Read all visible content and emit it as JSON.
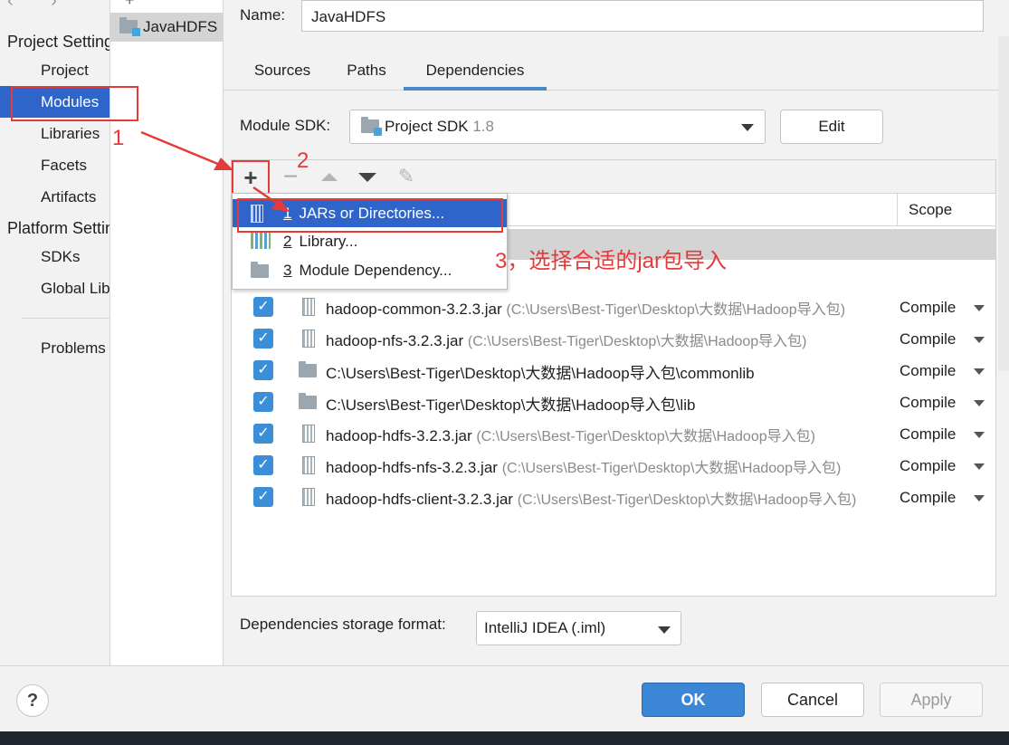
{
  "sidebar": {
    "nav_arrows": "‹ ›",
    "section_project": "Project Settings",
    "project_items": [
      "Project",
      "Modules",
      "Libraries",
      "Facets",
      "Artifacts"
    ],
    "section_platform": "Platform Settings",
    "platform_items": [
      "SDKs",
      "Global Libraries"
    ],
    "problems": "Problems"
  },
  "module_tree": {
    "add_symbol": "+",
    "module_name": "JavaHDFS"
  },
  "form": {
    "name_label": "Name:",
    "name_value": "JavaHDFS"
  },
  "tabs": [
    "Sources",
    "Paths",
    "Dependencies"
  ],
  "active_tab": "Dependencies",
  "sdk": {
    "label": "Module SDK:",
    "value": "Project SDK",
    "version": "1.8",
    "edit_label": "Edit"
  },
  "toolbar": {
    "add": "+",
    "remove": "−",
    "edit": "✎"
  },
  "table": {
    "scope_header": "Scope",
    "rows": [
      {
        "name": "hadoop-common-3.2.3.jar",
        "path": "(C:\\Users\\Best-Tiger\\Desktop\\大数据\\Hadoop导入包)",
        "scope": "Compile",
        "kind": "jar"
      },
      {
        "name": "hadoop-nfs-3.2.3.jar",
        "path": "(C:\\Users\\Best-Tiger\\Desktop\\大数据\\Hadoop导入包)",
        "scope": "Compile",
        "kind": "jar"
      },
      {
        "name": "C:\\Users\\Best-Tiger\\Desktop\\大数据\\Hadoop导入包\\commonlib",
        "path": "",
        "scope": "Compile",
        "kind": "dir"
      },
      {
        "name": "C:\\Users\\Best-Tiger\\Desktop\\大数据\\Hadoop导入包\\lib",
        "path": "",
        "scope": "Compile",
        "kind": "dir"
      },
      {
        "name": "hadoop-hdfs-3.2.3.jar",
        "path": "(C:\\Users\\Best-Tiger\\Desktop\\大数据\\Hadoop导入包)",
        "scope": "Compile",
        "kind": "jar"
      },
      {
        "name": "hadoop-hdfs-nfs-3.2.3.jar",
        "path": "(C:\\Users\\Best-Tiger\\Desktop\\大数据\\Hadoop导入包)",
        "scope": "Compile",
        "kind": "jar"
      },
      {
        "name": "hadoop-hdfs-client-3.2.3.jar",
        "path": "(C:\\Users\\Best-Tiger\\Desktop\\大数据\\Hadoop导入包)",
        "scope": "Compile",
        "kind": "jar"
      }
    ]
  },
  "popup": {
    "items": [
      {
        "mnemonic": "1",
        "label": "JARs or Directories..."
      },
      {
        "mnemonic": "2",
        "label": "Library..."
      },
      {
        "mnemonic": "3",
        "label": "Module Dependency..."
      }
    ]
  },
  "annotations": {
    "step1": "1",
    "step2": "2",
    "step3": "3，选择合适的jar包导入",
    "color": "#e53a3a"
  },
  "storage": {
    "label": "Dependencies storage format:",
    "value": "IntelliJ IDEA (.iml)"
  },
  "buttons": {
    "help": "?",
    "ok": "OK",
    "cancel": "Cancel",
    "apply": "Apply"
  },
  "colors": {
    "selection": "#2f65ca",
    "accent": "#3c86d6",
    "annotation": "#e53a3a"
  }
}
